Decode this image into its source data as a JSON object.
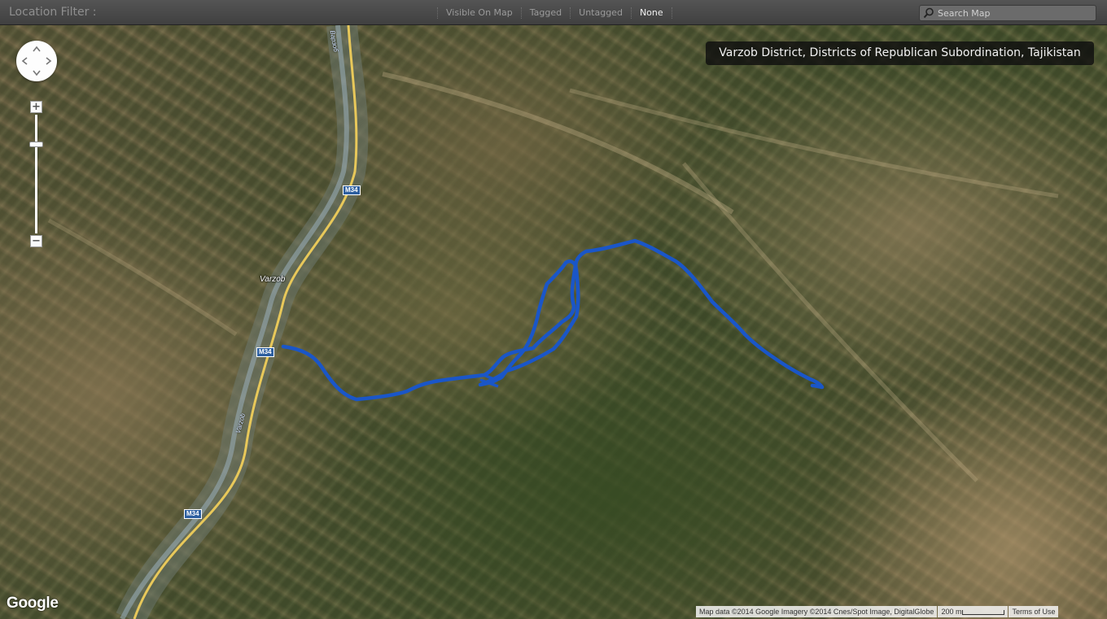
{
  "filter_bar": {
    "label": "Location Filter :",
    "options": [
      {
        "label": "Visible On Map",
        "active": false
      },
      {
        "label": "Tagged",
        "active": false
      },
      {
        "label": "Untagged",
        "active": false
      },
      {
        "label": "None",
        "active": true
      }
    ],
    "search": {
      "placeholder": "Search Map",
      "icon": "magnifier-icon"
    }
  },
  "map": {
    "location_banner": "Varzob District, Districts of Republican Subordination, Tajikistan",
    "view": "satellite",
    "track_color": "#1a56c8",
    "road_labels": [
      "M34",
      "M34",
      "M34"
    ],
    "town_label": "Varzob",
    "river_labels": [
      "Варзоб",
      "Varzob"
    ],
    "zoom_controls": {
      "zoom_in": "+",
      "zoom_out": "−"
    },
    "pan_control_icons": [
      "arrow-up-icon",
      "arrow-down-icon",
      "arrow-left-icon",
      "arrow-right-icon"
    ],
    "branding": "Google",
    "attribution": "Map data ©2014 Google Imagery ©2014 Cnes/Spot Image, DigitalGlobe",
    "scale_label": "200 m",
    "terms_link": "Terms of Use"
  }
}
